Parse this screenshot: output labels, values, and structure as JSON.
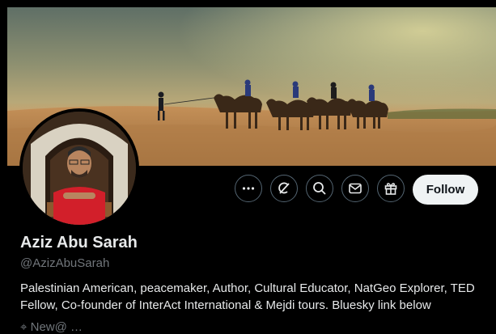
{
  "profile": {
    "name": "Aziz Abu Sarah",
    "handle": "@AzizAbuSarah",
    "bio": "Palestinian American, peacemaker, Author, Cultural Educator, NatGeo Explorer, TED Fellow, Co-founder of InterAct International & Mejdi tours. Bluesky link below",
    "meta_partial": "New@ …"
  },
  "actions": {
    "follow_label": "Follow",
    "icons": [
      "more-icon",
      "grok-icon",
      "search-icon",
      "message-icon",
      "gift-icon"
    ]
  },
  "colors": {
    "background": "#000000",
    "text": "#e7e9ea",
    "muted": "#71767b",
    "button_border": "#536471",
    "follow_bg": "#eff3f4"
  }
}
